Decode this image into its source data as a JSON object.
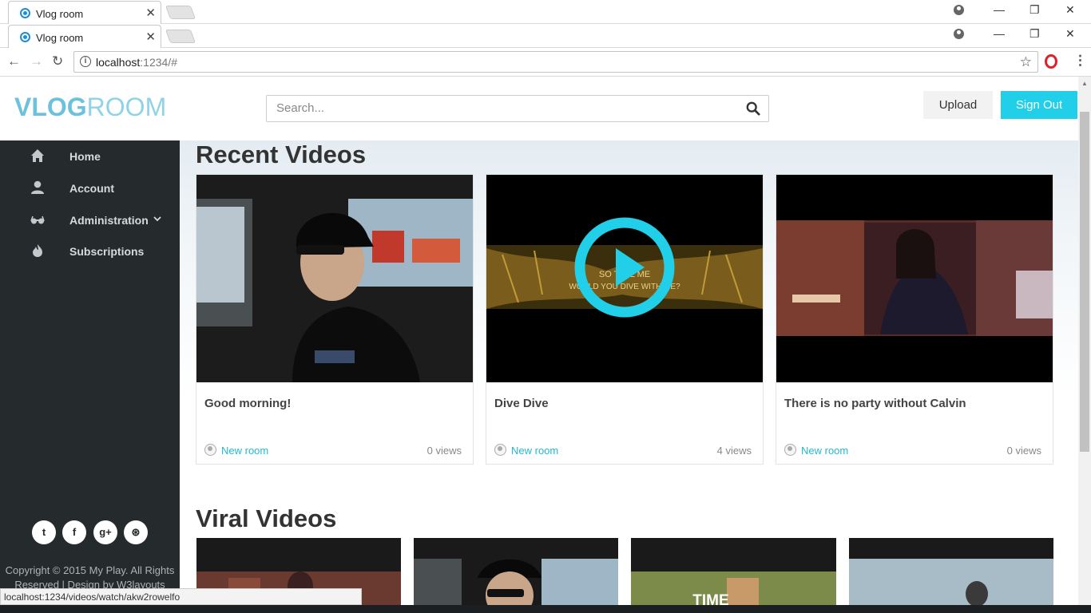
{
  "browser": {
    "tab_title": "Vlog room",
    "url_host": "localhost",
    "url_path": ":1234/#",
    "status_url": "localhost:1234/videos/watch/akw2rowelfo"
  },
  "header": {
    "logo_bold": "VLOG",
    "logo_light": "ROOM",
    "search_placeholder": "Search...",
    "upload_label": "Upload",
    "signout_label": "Sign Out",
    "accent_color": "#21d0e8"
  },
  "sidebar": {
    "items": [
      {
        "label": "Home",
        "icon": "home-icon"
      },
      {
        "label": "Account",
        "icon": "user-icon"
      },
      {
        "label": "Administration",
        "icon": "glasses-icon"
      },
      {
        "label": "Subscriptions",
        "icon": "fire-icon"
      }
    ],
    "social": [
      "twitter-icon",
      "facebook-icon",
      "google-plus-icon",
      "dribbble-icon"
    ],
    "copyright_line1": "Copyright © 2015 My Play. All Rights",
    "copyright_line2": "Reserved | Design by W3layouts"
  },
  "recent": {
    "title": "Recent Videos",
    "videos": [
      {
        "title": "Good morning!",
        "channel": "New room",
        "views": "0 views"
      },
      {
        "title": "Dive Dive",
        "channel": "New room",
        "views": "4 views",
        "overlay_text_1": "SO TELL ME",
        "overlay_text_2": "WOULD YOU DIVE WITH ME?"
      },
      {
        "title": "There is no party without Calvin",
        "channel": "New room",
        "views": "0 views"
      }
    ]
  },
  "viral": {
    "title": "Viral Videos",
    "thumb_text": "TIME"
  }
}
